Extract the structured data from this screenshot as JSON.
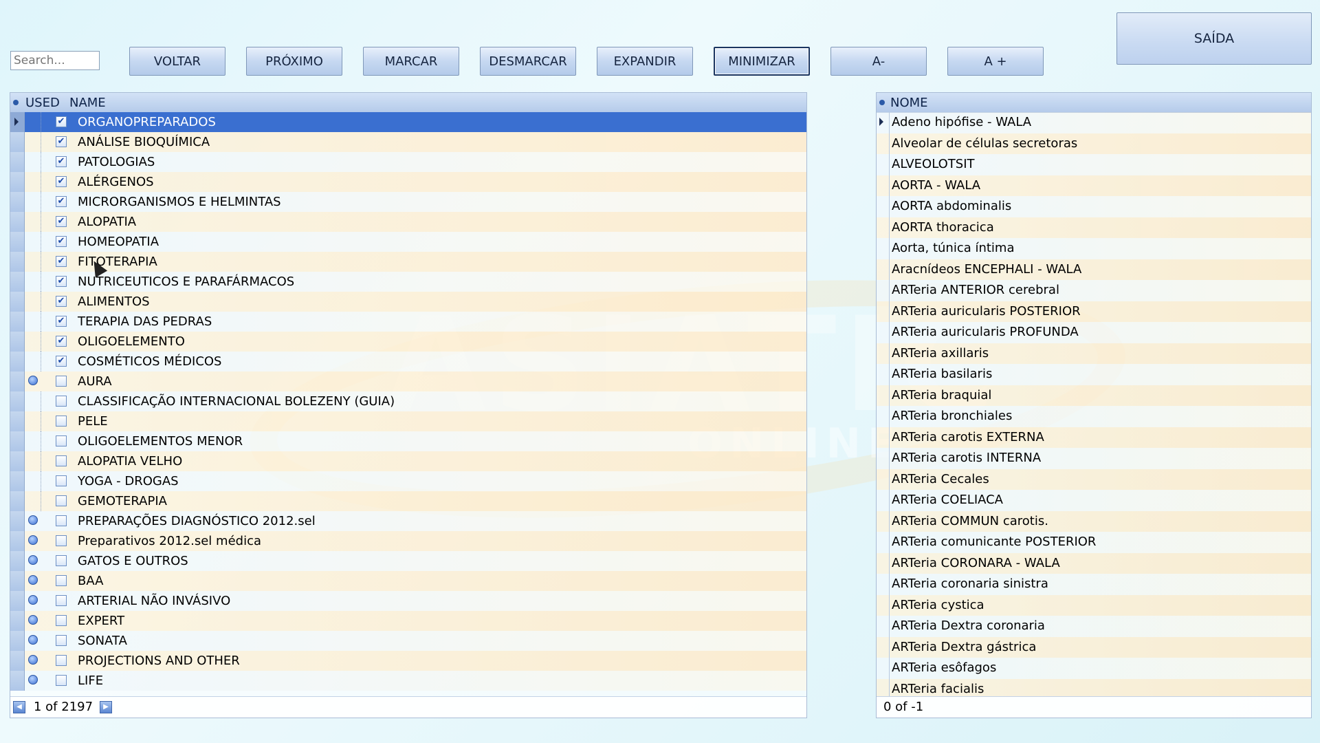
{
  "search": {
    "placeholder": "Search..."
  },
  "toolbar": {
    "voltar": "VOLTAR",
    "proximo": "PRÓXIMO",
    "marcar": "MARCAR",
    "desmarcar": "DESMARCAR",
    "expandir": "EXPANDIR",
    "minimizar": "MINIMIZAR",
    "font_down": "A-",
    "font_up": "A +",
    "exit": "SAÍDA"
  },
  "left_grid": {
    "col_used": "USED",
    "col_name": "NAME",
    "rows": [
      {
        "name": "ORGANOPREPARADOS",
        "checked": true,
        "expandable": false
      },
      {
        "name": "ANÁLISE BIOQUÍMICA",
        "checked": true,
        "expandable": false
      },
      {
        "name": "PATOLOGIAS",
        "checked": true,
        "expandable": false
      },
      {
        "name": "ALÉRGENOS",
        "checked": true,
        "expandable": false
      },
      {
        "name": "MICRORGANISMOS E HELMINTAS",
        "checked": true,
        "expandable": false
      },
      {
        "name": "ALOPATIA",
        "checked": true,
        "expandable": false
      },
      {
        "name": "HOMEOPATIA",
        "checked": true,
        "expandable": false
      },
      {
        "name": "FITOTERAPIA",
        "checked": true,
        "expandable": false
      },
      {
        "name": "NUTRICEUTICOS E PARAFÁRMACOS",
        "checked": true,
        "expandable": false
      },
      {
        "name": "ALIMENTOS",
        "checked": true,
        "expandable": false
      },
      {
        "name": "TERAPIA DAS PEDRAS",
        "checked": true,
        "expandable": false
      },
      {
        "name": "OLIGOELEMENTO",
        "checked": true,
        "expandable": false
      },
      {
        "name": "COSMÉTICOS MÉDICOS",
        "checked": true,
        "expandable": false
      },
      {
        "name": "AURA",
        "checked": false,
        "expandable": true
      },
      {
        "name": "CLASSIFICAÇÃO INTERNACIONAL BOLEZENY (GUIA)",
        "checked": false,
        "expandable": false
      },
      {
        "name": "PELE",
        "checked": false,
        "expandable": false
      },
      {
        "name": "OLIGOELEMENTOS MENOR",
        "checked": false,
        "expandable": false
      },
      {
        "name": "ALOPATIA VELHO",
        "checked": false,
        "expandable": false
      },
      {
        "name": "YOGA - DROGAS",
        "checked": false,
        "expandable": false
      },
      {
        "name": "GEMOTERAPIA",
        "checked": false,
        "expandable": false
      },
      {
        "name": "PREPARAÇÕES DIAGNÓSTICO 2012.sel",
        "checked": false,
        "expandable": true
      },
      {
        "name": "Preparativos 2012.sel médica",
        "checked": false,
        "expandable": true
      },
      {
        "name": "GATOS E OUTROS",
        "checked": false,
        "expandable": true
      },
      {
        "name": "BAA",
        "checked": false,
        "expandable": true
      },
      {
        "name": "ARTERIAL NÃO INVÁSIVO",
        "checked": false,
        "expandable": true
      },
      {
        "name": "EXPERT",
        "checked": false,
        "expandable": true
      },
      {
        "name": "SONATA",
        "checked": false,
        "expandable": true
      },
      {
        "name": "PROJECTIONS AND OTHER",
        "checked": false,
        "expandable": true
      },
      {
        "name": "LIFE",
        "checked": false,
        "expandable": true
      }
    ],
    "pager": "1 of 2197"
  },
  "right_grid": {
    "col_name": "NOME",
    "rows": [
      "Adeno hipófise - WALA",
      "Alveolar de células secretoras",
      "ALVEOLOTSIT",
      "AORTA - WALA",
      "AORTA abdominalis",
      "AORTA thoracica",
      "Aorta, túnica íntima",
      "Aracnídeos ENCEPHALI - WALA",
      "ARTeria ANTERIOR cerebral",
      "ARTeria auricularis POSTERIOR",
      "ARTeria auricularis PROFUNDA",
      "ARTeria axillaris",
      "ARTeria basilaris",
      "ARTeria braquial",
      "ARTeria bronchiales",
      "ARTeria carotis EXTERNA",
      "ARTeria carotis INTERNA",
      "ARTeria Cecales",
      "ARTeria COELIACA",
      "ARTeria COMMUN carotis.",
      "ARTeria comunicante POSTERIOR",
      "ARTeria CORONARA - WALA",
      "ARTeria coronaria sinistra",
      "ARTeria cystica",
      "ARTeria Dextra coronaria",
      "ARTeria Dextra gástrica",
      "ARTeria esôfagos",
      "ARTeria facialis"
    ],
    "pager": "0 of -1"
  },
  "watermark": {
    "brand": "ASIATIC",
    "sub": "ONLINE"
  }
}
